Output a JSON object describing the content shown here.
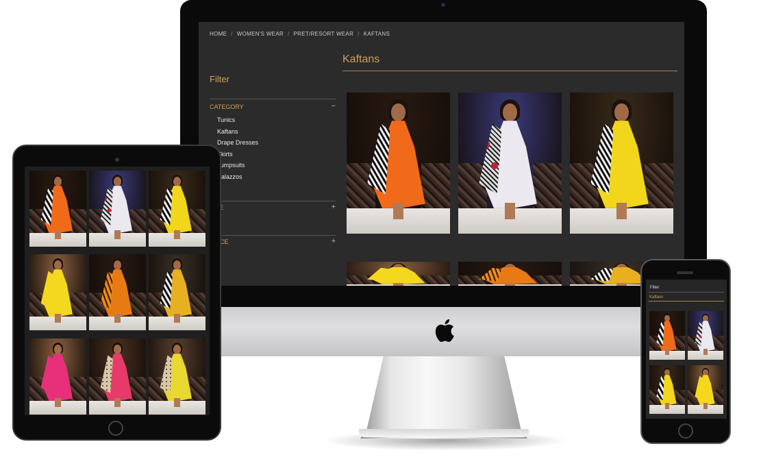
{
  "breadcrumb": {
    "items": [
      "HOME",
      "WOMEN'S WEAR",
      "PRET/RESORT WEAR",
      "KAFTANS"
    ],
    "separator": "/"
  },
  "sidebar": {
    "title": "Filter",
    "category": {
      "label": "CATEGORY",
      "toggle": "−",
      "items": [
        "Tunics",
        "Kaftans",
        "Drape Dresses",
        "Skirts",
        "Jumpsuits",
        "Palazzos"
      ]
    },
    "sections": [
      {
        "label": "SIZE",
        "toggle": "+"
      },
      {
        "label": "PRICE",
        "toggle": "+"
      }
    ]
  },
  "main": {
    "title": "Kaftans"
  },
  "mobile": {
    "filter_label": "Filter",
    "title": "Kaftans"
  },
  "colors": {
    "accent": "#c9a15a",
    "screen_bg": "#2b2b2b",
    "text": "#e8e8e8"
  },
  "products": [
    {
      "image": "model-orange-kaftan-photo",
      "garment": "#f06a1a",
      "drape": "stripe-black-white",
      "bg": "#2a1a12"
    },
    {
      "image": "model-floral-print-kaftan-photo",
      "garment": "#ece8f0",
      "drape": "floral-red",
      "bg": "#3a3a7a"
    },
    {
      "image": "model-yellow-kaftan-photo",
      "garment": "#f1d61c",
      "drape": "stripe-black-white",
      "bg": "#3a2a1a"
    },
    {
      "image": "model-yellow-drape-photo",
      "garment": "#f4d81e",
      "drape": "solid",
      "bg": "#8a6040"
    },
    {
      "image": "model-orange-stripe-photo",
      "garment": "#e87a14",
      "drape": "stripe-orange",
      "bg": "#2a1a14"
    },
    {
      "image": "model-yellow-ombre-kaftan-photo",
      "garment": "#e8b020",
      "drape": "stripe-black-white",
      "bg": "#3a3028"
    },
    {
      "image": "model-pink-dress-photo",
      "garment": "#e8307a",
      "drape": "solid",
      "bg": "#8a6040"
    },
    {
      "image": "model-pink-white-print-photo",
      "garment": "#e83a6a",
      "drape": "leopard",
      "bg": "#4a3020"
    },
    {
      "image": "model-yellow-white-dress-photo",
      "garment": "#e8d830",
      "drape": "leopard",
      "bg": "#5a4030"
    }
  ]
}
